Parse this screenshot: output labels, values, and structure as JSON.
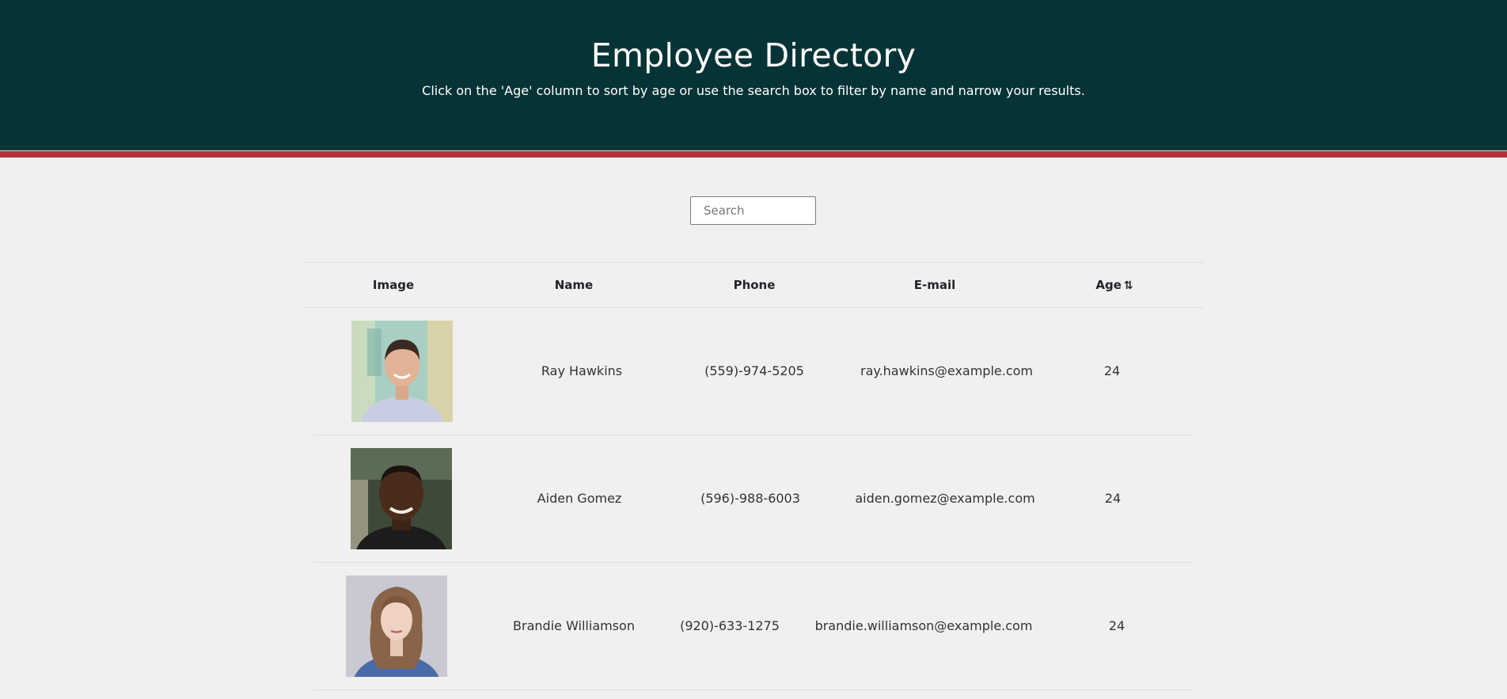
{
  "header": {
    "title": "Employee Directory",
    "subtitle": "Click on the 'Age' column to sort by age or use the search box to filter by name and narrow your results."
  },
  "search": {
    "placeholder": "Search",
    "value": ""
  },
  "table": {
    "columns": [
      "Image",
      "Name",
      "Phone",
      "E-mail",
      "Age"
    ],
    "sort_icon": "sort-arrows-icon",
    "rows": [
      {
        "name": "Ray Hawkins",
        "phone": "(559)-974-5205",
        "email": "ray.hawkins@example.com",
        "age": "24"
      },
      {
        "name": "Aiden Gomez",
        "phone": "(596)-988-6003",
        "email": "aiden.gomez@example.com",
        "age": "24"
      },
      {
        "name": "Brandie Williamson",
        "phone": "(920)-633-1275",
        "email": "brandie.williamson@example.com",
        "age": "24"
      }
    ]
  },
  "colors": {
    "header_bg": "#063436",
    "accent_border": "#b3313a",
    "page_bg": "#f0f0f0"
  }
}
